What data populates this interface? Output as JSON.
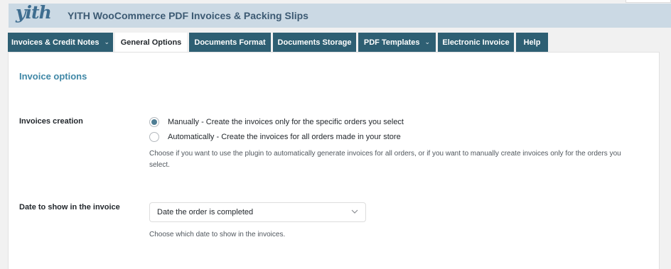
{
  "header": {
    "logo_text": "yith",
    "title": "YITH WooCommerce PDF Invoices & Packing Slips"
  },
  "tabs": [
    {
      "label": "Invoices & Credit Notes",
      "has_dropdown": true,
      "active": false
    },
    {
      "label": "General Options",
      "has_dropdown": false,
      "active": true
    },
    {
      "label": "Documents Format",
      "has_dropdown": false,
      "active": false
    },
    {
      "label": "Documents Storage",
      "has_dropdown": false,
      "active": false
    },
    {
      "label": "PDF Templates",
      "has_dropdown": true,
      "active": false
    },
    {
      "label": "Electronic Invoice",
      "has_dropdown": false,
      "active": false
    },
    {
      "label": "Help",
      "has_dropdown": false,
      "active": false
    }
  ],
  "section": {
    "title": "Invoice options"
  },
  "invoices_creation": {
    "label": "Invoices creation",
    "options": [
      {
        "label": "Manually - Create the invoices only for the specific orders you select",
        "checked": true
      },
      {
        "label": "Automatically - Create the invoices for all orders made in your store",
        "checked": false
      }
    ],
    "help_line1": "Choose if you want to use the plugin to automatically generate invoices for all orders, or if you want to manually create invoices only for the orders you",
    "help_line2": "select."
  },
  "date_field": {
    "label": "Date to show in the invoice",
    "selected": "Date the order is completed",
    "help": "Choose which date to show in the invoices."
  },
  "colors": {
    "tab_bg": "#2e5f73",
    "header_bg": "#cbd9e4",
    "accent": "#3f87a6",
    "radio_checked": "#4f7e94"
  },
  "icons": {
    "tab_dropdown": "chevron-down-icon",
    "select_dropdown": "chevron-down-icon",
    "radio_selected": "radio-checked-icon"
  }
}
